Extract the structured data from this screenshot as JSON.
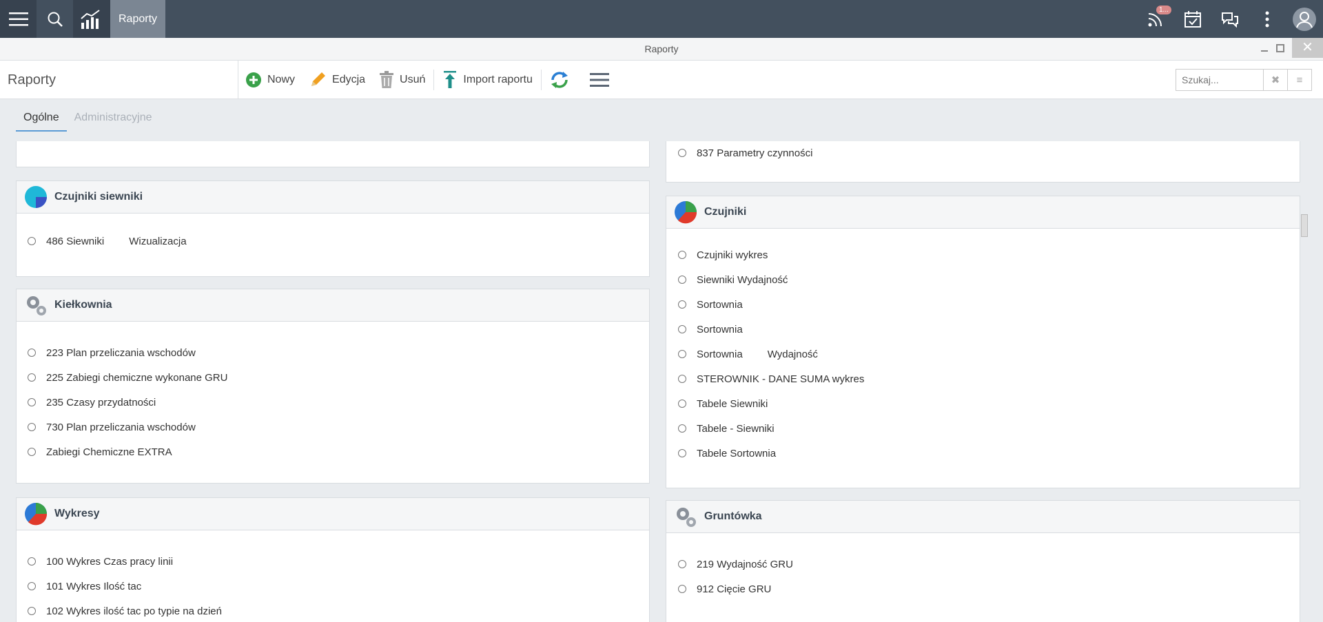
{
  "topbar": {
    "active_tab": "Raporty",
    "notification_badge": "1..."
  },
  "window": {
    "title": "Raporty",
    "close": "✕"
  },
  "toolbar": {
    "title": "Raporty",
    "actions": {
      "new": "Nowy",
      "edit": "Edycja",
      "delete": "Usuń",
      "import": "Import raportu"
    },
    "search": {
      "placeholder": "Szukaj...",
      "clear": "✖",
      "menu": "≡"
    }
  },
  "tabs": [
    "Ogólne",
    "Administracyjne"
  ],
  "left": {
    "czujniki_siewniki": {
      "title": "Czujniki siewniki",
      "items": [
        {
          "label": "486 Siewniki",
          "extra": "Wizualizacja"
        }
      ]
    },
    "kielkownia": {
      "title": "Kiełkownia",
      "items": [
        "223 Plan przeliczania wschodów",
        "225 Zabiegi chemiczne wykonane GRU",
        "235 Czasy przydatności",
        "730 Plan przeliczania wschodów",
        "Zabiegi Chemiczne EXTRA"
      ]
    },
    "wykresy": {
      "title": "Wykresy",
      "items": [
        "100 Wykres Czas pracy linii",
        "101 Wykres Ilość tac",
        "102 Wykres ilość tac po typie na dzień"
      ]
    }
  },
  "right": {
    "top_partial": {
      "item": "837 Parametry czynności"
    },
    "czujniki": {
      "title": "Czujniki",
      "items": [
        {
          "label": "Czujniki wykres"
        },
        {
          "label": "Siewniki Wydajność"
        },
        {
          "label": "Sortownia"
        },
        {
          "label": "Sortownia"
        },
        {
          "label": "Sortownia",
          "extra": "Wydajność"
        },
        {
          "label": "STEROWNIK - DANE SUMA wykres"
        },
        {
          "label": "Tabele Siewniki"
        },
        {
          "label": "Tabele - Siewniki"
        },
        {
          "label": "Tabele Sortownia"
        }
      ]
    },
    "gruntowka": {
      "title": "Gruntówka",
      "items": [
        "219 Wydajność GRU",
        "912 Cięcie GRU"
      ]
    }
  },
  "colors": {
    "topbar": "#43505e",
    "accent": "#5b9bd5",
    "new": "#3aa14a",
    "edit": "#f0a020"
  }
}
